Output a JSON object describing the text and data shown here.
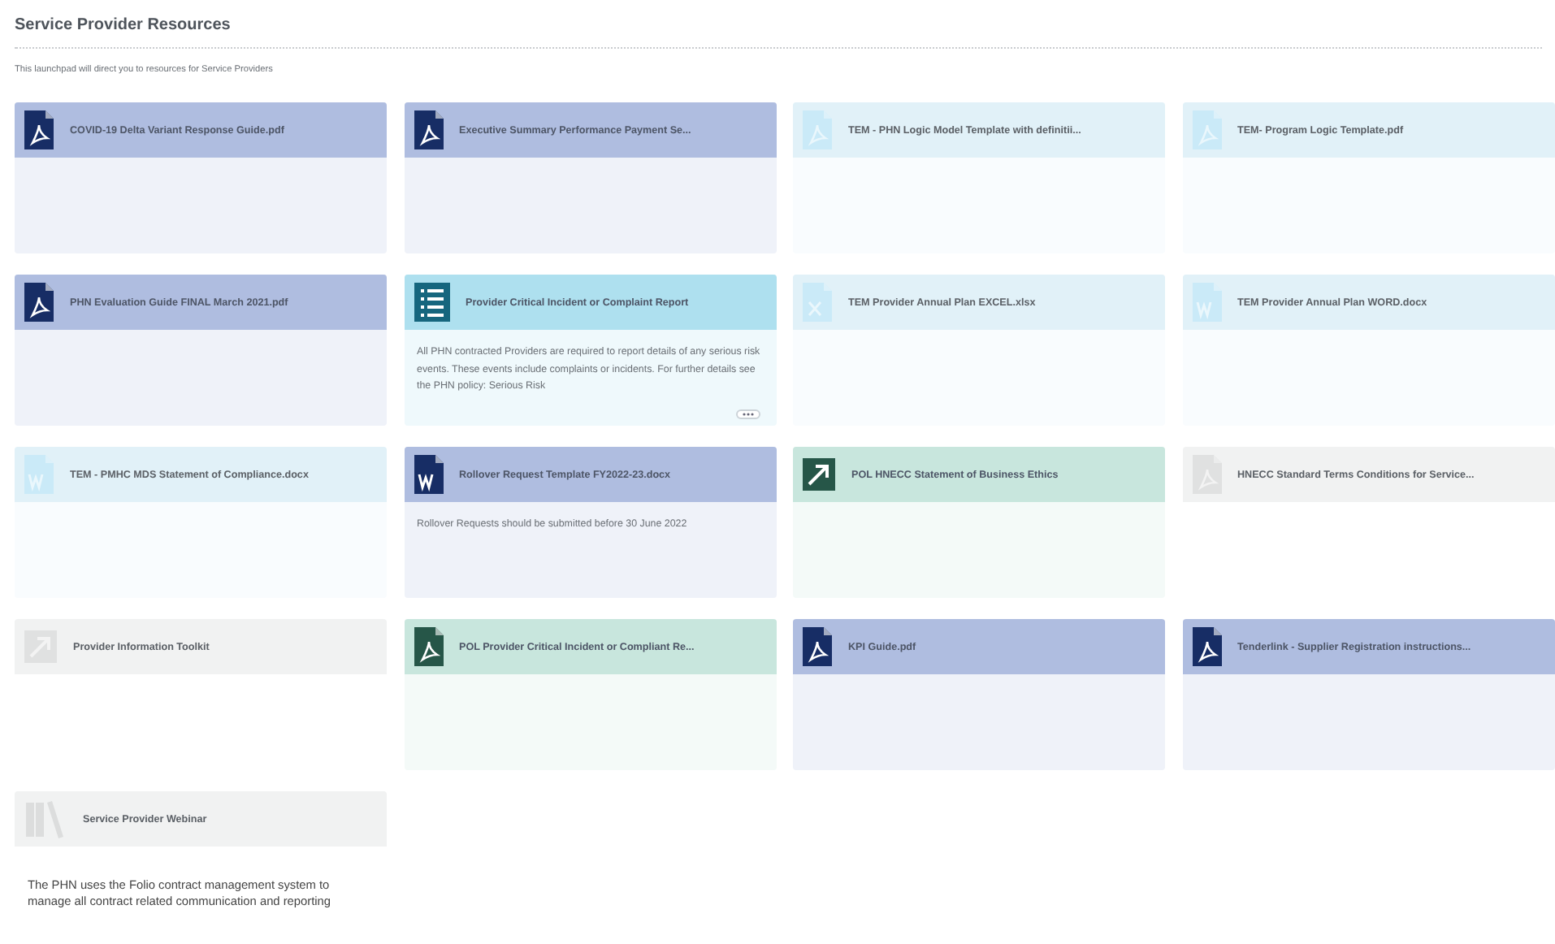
{
  "page": {
    "title": "Service Provider Resources",
    "subtitle": "This launchpad will direct you to resources for Service Providers"
  },
  "cards": [
    {
      "title": "COVID-19 Delta Variant Response Guide.pdf",
      "color": "#afbde0",
      "kind": "pdf"
    },
    {
      "title": "Executive Summary Performance Payment Se...",
      "color": "#afbde0",
      "kind": "pdf"
    },
    {
      "title": "TEM - PHN Logic Model Template with definitii...",
      "color": "#e1f1f8",
      "kind": "pdf"
    },
    {
      "title": "TEM- Program Logic Template.pdf",
      "color": "#e1f1f8",
      "kind": "pdf"
    },
    {
      "title": "PHN Evaluation Guide FINAL March 2021.pdf",
      "color": "#afbde0",
      "kind": "pdf"
    },
    {
      "title": "Provider Critical Incident or Complaint Report",
      "color": "#aee0ef",
      "kind": "list",
      "description": "All PHN contracted Providers are required to report details of any serious risk events. These events include complaints or incidents. For further details see the PHN policy: Serious Risk",
      "more": true
    },
    {
      "title": "TEM Provider Annual Plan EXCEL.xlsx",
      "color": "#e1f1f8",
      "kind": "spreadsheet"
    },
    {
      "title": "TEM Provider Annual Plan WORD.docx",
      "color": "#e1f1f8",
      "kind": "word"
    },
    {
      "title": "TEM - PMHC MDS Statement of Compliance.docx",
      "color": "#e1f1f8",
      "kind": "word"
    },
    {
      "title": "Rollover Request Template FY2022-23.docx",
      "color": "#afbde0",
      "kind": "word",
      "description": "Rollover Requests should be submitted before 30 June 2022"
    },
    {
      "title": "POL HNECC Statement of Business Ethics",
      "color": "#c8e6dd",
      "kind": "link"
    },
    {
      "title": "HNECC Standard Terms Conditions for Service...",
      "color": "#f1f2f2",
      "kind": "pdf"
    },
    {
      "title": "Provider Information Toolkit",
      "color": "#f1f2f2",
      "kind": "link"
    },
    {
      "title": "POL Provider Critical Incident or Compliant Re...",
      "color": "#c8e6dd",
      "kind": "pdf"
    },
    {
      "title": "KPI Guide.pdf",
      "color": "#afbde0",
      "kind": "pdf"
    },
    {
      "title": "Tenderlink - Supplier Registration instructions...",
      "color": "#afbde0",
      "kind": "pdf"
    },
    {
      "title": "Service Provider Webinar",
      "color": "#f1f2f2",
      "kind": "video",
      "description": "The PHN uses the Folio contract management system to manage all contract related communication and reporting"
    }
  ]
}
